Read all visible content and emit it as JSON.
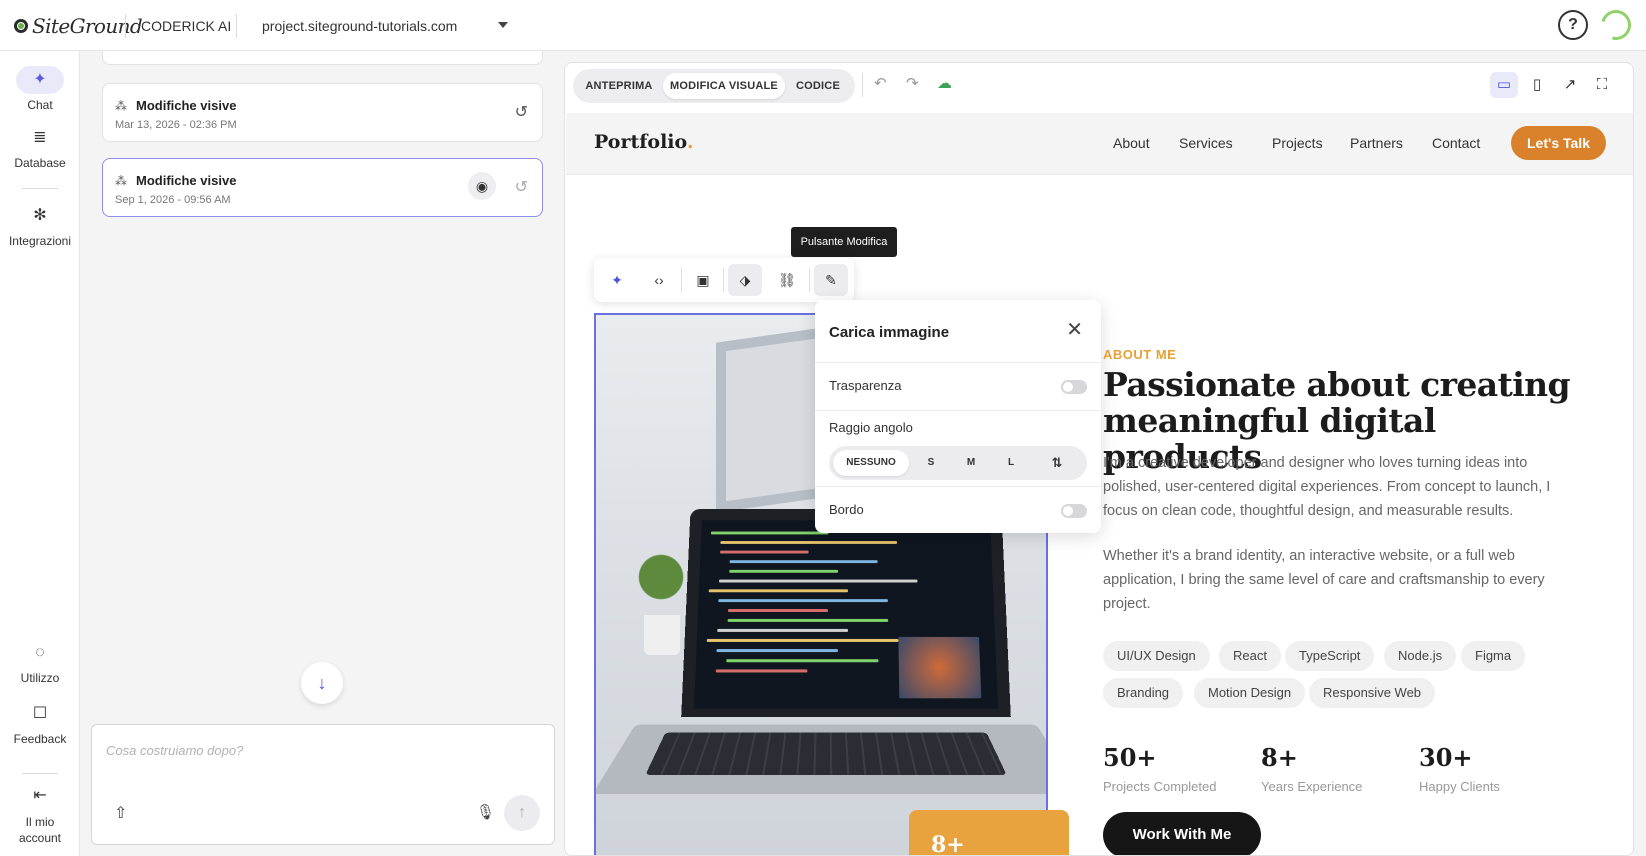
{
  "header": {
    "logo": "SiteGround",
    "product": "CODERICK AI",
    "domain": "project.siteground-tutorials.com",
    "help_glyph": "?"
  },
  "leftnav": {
    "items": [
      {
        "label": "Chat",
        "icon": "sparkle-icon",
        "glyph": "✦"
      },
      {
        "label": "Database",
        "icon": "database-icon",
        "glyph": "≣"
      },
      {
        "label": "Integrazioni",
        "icon": "integrations-icon",
        "glyph": "✻"
      }
    ],
    "bottom": [
      {
        "label": "Utilizzo",
        "icon": "usage-icon",
        "glyph": "◌"
      },
      {
        "label": "Feedback",
        "icon": "feedback-icon",
        "glyph": "☐"
      },
      {
        "label": "Il mio account",
        "icon": "logout-icon",
        "glyph": "⇤"
      }
    ]
  },
  "history": [
    {
      "title": "Modifiche visive",
      "date": "Mar 13, 2026 - 02:36 PM"
    },
    {
      "title": "Modifiche visive",
      "date": "Sep 1, 2026 - 09:56 AM"
    }
  ],
  "composer": {
    "placeholder": "Cosa costruiamo dopo?"
  },
  "editor": {
    "tabs": [
      "ANTEPRIMA",
      "MODIFICA VISUALE",
      "CODICE"
    ],
    "active_tab": "MODIFICA VISUALE",
    "tooltip": "Pulsante Modifica"
  },
  "site": {
    "logo": "Portfolio",
    "logo_dot": ".",
    "nav": [
      "About",
      "Services",
      "Projects",
      "Partners",
      "Contact"
    ],
    "cta": "Let's Talk",
    "about_label": "ABOUT ME",
    "about_title": "Passionate about creating meaningful digital products",
    "p1": "I'm a creative developer and designer who loves turning ideas into polished, user-centered digital experiences. From concept to launch, I focus on clean code, thoughtful design, and measurable results.",
    "p2": "Whether it's a brand identity, an interactive website, or a full web application, I bring the same level of care and craftsmanship to every project.",
    "skills": [
      "UI/UX Design",
      "React",
      "TypeScript",
      "Node.js",
      "Figma",
      "Branding",
      "Motion Design",
      "Responsive Web"
    ],
    "stats": [
      {
        "num": "50+",
        "label": "Projects Completed"
      },
      {
        "num": "8+",
        "label": "Years Experience"
      },
      {
        "num": "30+",
        "label": "Happy Clients"
      }
    ],
    "work_btn": "Work With Me",
    "badge": "8+"
  },
  "popover": {
    "title": "Carica immagine",
    "transparency": "Trasparenza",
    "radius": "Raggio angolo",
    "radius_options": [
      "NESSUNO",
      "S",
      "M",
      "L"
    ],
    "radius_selected": "NESSUNO",
    "border": "Bordo",
    "transparency_on": false,
    "border_on": false
  },
  "colors": {
    "accent": "#5a5fd8",
    "orange": "#d9822b",
    "brand_green": "#6ab04c"
  }
}
